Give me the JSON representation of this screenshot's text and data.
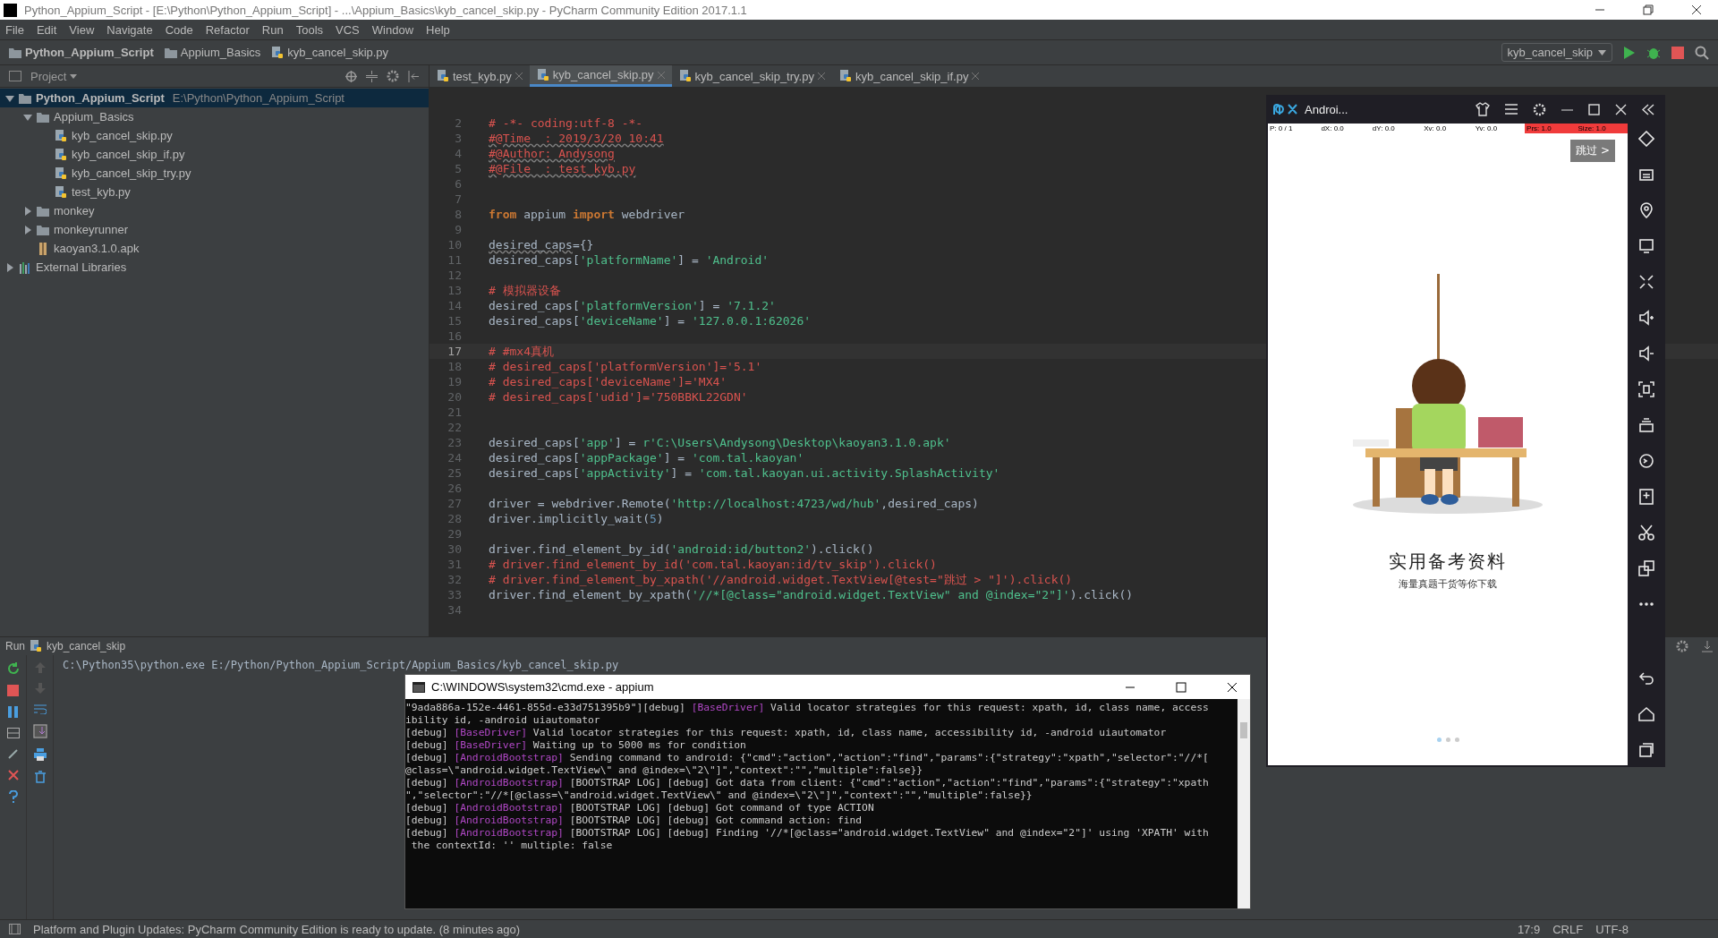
{
  "window": {
    "title": "Python_Appium_Script - [E:\\Python\\Python_Appium_Script] - ...\\Appium_Basics\\kyb_cancel_skip.py - PyCharm Community Edition 2017.1.1"
  },
  "menu": [
    "File",
    "Edit",
    "View",
    "Navigate",
    "Code",
    "Refactor",
    "Run",
    "Tools",
    "VCS",
    "Window",
    "Help"
  ],
  "breadcrumbs": [
    {
      "label": "Python_Appium_Script",
      "kind": "project"
    },
    {
      "label": "Appium_Basics",
      "kind": "folder"
    },
    {
      "label": "kyb_cancel_skip.py",
      "kind": "python"
    }
  ],
  "run_config": "kyb_cancel_skip",
  "project_panel": {
    "title": "Project"
  },
  "project_tree": [
    {
      "label": "Python_Appium_Script",
      "path": "E:\\Python\\Python_Appium_Script",
      "kind": "project",
      "expanded": true,
      "selected": true,
      "children": [
        {
          "label": "Appium_Basics",
          "kind": "folder",
          "expanded": true,
          "selected": false,
          "children": [
            {
              "label": "kyb_cancel_skip.py",
              "kind": "python",
              "selected": false
            },
            {
              "label": "kyb_cancel_skip_if.py",
              "kind": "python",
              "selected": false
            },
            {
              "label": "kyb_cancel_skip_try.py",
              "kind": "python",
              "selected": false
            },
            {
              "label": "test_kyb.py",
              "kind": "python",
              "selected": false
            }
          ]
        },
        {
          "label": "monkey",
          "kind": "folder",
          "expanded": false,
          "selected": false
        },
        {
          "label": "monkeyrunner",
          "kind": "folder",
          "expanded": false,
          "selected": false
        },
        {
          "label": "kaoyan3.1.0.apk",
          "kind": "apk",
          "selected": false
        }
      ]
    },
    {
      "label": "External Libraries",
      "kind": "library",
      "expanded": false,
      "selected": false
    }
  ],
  "tabs": [
    {
      "label": "test_kyb.py",
      "selected": false
    },
    {
      "label": "kyb_cancel_skip.py",
      "selected": true
    },
    {
      "label": "kyb_cancel_skip_try.py",
      "selected": false
    },
    {
      "label": "kyb_cancel_skip_if.py",
      "selected": false
    }
  ],
  "code": [
    {
      "number": "2",
      "current": false,
      "tokens": [
        {
          "kind": "comment",
          "text": "# -*- coding:utf-8 -*-"
        }
      ]
    },
    {
      "number": "3",
      "current": false,
      "tokens": [
        {
          "kind": "comment",
          "text": "#@Time  : 2019/3/20 10:41",
          "wavy": true
        }
      ]
    },
    {
      "number": "4",
      "current": false,
      "tokens": [
        {
          "kind": "comment",
          "text": "#@Author: Andysong",
          "wavy": true
        }
      ]
    },
    {
      "number": "5",
      "current": false,
      "tokens": [
        {
          "kind": "comment",
          "text": "#@File  : test_kyb.py",
          "wavy": true
        }
      ]
    },
    {
      "number": "6",
      "current": false
    },
    {
      "number": "7",
      "current": false
    },
    {
      "number": "8",
      "current": false,
      "tokens": [
        {
          "kind": "keyword",
          "text": "from"
        },
        {
          "kind": "plain",
          "text": " appium "
        },
        {
          "kind": "keyword",
          "text": "import"
        },
        {
          "kind": "plain",
          "text": " webdriver"
        }
      ]
    },
    {
      "number": "9",
      "current": false
    },
    {
      "number": "10",
      "current": false,
      "tokens": [
        {
          "kind": "plain",
          "text": "desired_caps",
          "wavy": true
        },
        {
          "kind": "plain",
          "text": "={}"
        }
      ]
    },
    {
      "number": "11",
      "current": false,
      "tokens": [
        {
          "kind": "plain",
          "text": "desired_caps["
        },
        {
          "kind": "string",
          "text": "'platformName'"
        },
        {
          "kind": "plain",
          "text": "] = "
        },
        {
          "kind": "string",
          "text": "'Android'"
        }
      ]
    },
    {
      "number": "12",
      "current": false
    },
    {
      "number": "13",
      "current": false,
      "tokens": [
        {
          "kind": "comment",
          "text": "# 模拟器设备"
        }
      ]
    },
    {
      "number": "14",
      "current": false,
      "tokens": [
        {
          "kind": "plain",
          "text": "desired_caps["
        },
        {
          "kind": "string",
          "text": "'platformVersion'"
        },
        {
          "kind": "plain",
          "text": "] = "
        },
        {
          "kind": "string",
          "text": "'7.1.2'"
        }
      ]
    },
    {
      "number": "15",
      "current": false,
      "tokens": [
        {
          "kind": "plain",
          "text": "desired_caps["
        },
        {
          "kind": "string",
          "text": "'deviceName'"
        },
        {
          "kind": "plain",
          "text": "] = "
        },
        {
          "kind": "string",
          "text": "'127.0.0.1:62026'"
        }
      ]
    },
    {
      "number": "16",
      "current": false
    },
    {
      "number": "17",
      "current": true,
      "tokens": [
        {
          "kind": "comment",
          "text": "# #mx4真机"
        }
      ]
    },
    {
      "number": "18",
      "current": false,
      "tokens": [
        {
          "kind": "comment",
          "text": "# desired_caps['platformVersion']='5.1'"
        }
      ]
    },
    {
      "number": "19",
      "current": false,
      "tokens": [
        {
          "kind": "comment",
          "text": "# desired_caps['deviceName']='MX4'"
        }
      ]
    },
    {
      "number": "20",
      "current": false,
      "tokens": [
        {
          "kind": "comment",
          "text": "# desired_caps['udid']='750BBKL22GDN'"
        }
      ]
    },
    {
      "number": "21",
      "current": false
    },
    {
      "number": "22",
      "current": false
    },
    {
      "number": "23",
      "current": false,
      "tokens": [
        {
          "kind": "plain",
          "text": "desired_caps["
        },
        {
          "kind": "string",
          "text": "'app'"
        },
        {
          "kind": "plain",
          "text": "] = "
        },
        {
          "kind": "string",
          "text": "r'C:\\Users\\Andysong\\Desktop\\kaoyan3.1.0.apk'"
        }
      ]
    },
    {
      "number": "24",
      "current": false,
      "tokens": [
        {
          "kind": "plain",
          "text": "desired_caps["
        },
        {
          "kind": "string",
          "text": "'appPackage'"
        },
        {
          "kind": "plain",
          "text": "] = "
        },
        {
          "kind": "string",
          "text": "'com.tal.kaoyan'"
        }
      ]
    },
    {
      "number": "25",
      "current": false,
      "tokens": [
        {
          "kind": "plain",
          "text": "desired_caps["
        },
        {
          "kind": "string",
          "text": "'appActivity'"
        },
        {
          "kind": "plain",
          "text": "] = "
        },
        {
          "kind": "string",
          "text": "'com.tal.kaoyan.ui.activity.SplashActivity'"
        }
      ]
    },
    {
      "number": "26",
      "current": false
    },
    {
      "number": "27",
      "current": false,
      "tokens": [
        {
          "kind": "plain",
          "text": "driver = webdriver.Remote("
        },
        {
          "kind": "string",
          "text": "'http://localhost:4723/wd/hub'"
        },
        {
          "kind": "plain",
          "text": ",desired_caps)"
        }
      ]
    },
    {
      "number": "28",
      "current": false,
      "tokens": [
        {
          "kind": "plain",
          "text": "driver.implicitly_wait("
        },
        {
          "kind": "number",
          "text": "5"
        },
        {
          "kind": "plain",
          "text": ")"
        }
      ]
    },
    {
      "number": "29",
      "current": false
    },
    {
      "number": "30",
      "current": false,
      "tokens": [
        {
          "kind": "plain",
          "text": "driver.find_element_by_id("
        },
        {
          "kind": "string",
          "text": "'android:id/button2'"
        },
        {
          "kind": "plain",
          "text": ").click()"
        }
      ]
    },
    {
      "number": "31",
      "current": false,
      "tokens": [
        {
          "kind": "comment",
          "text": "# driver.find_element_by_id('com.tal.kaoyan:id/tv_skip').click()"
        }
      ]
    },
    {
      "number": "32",
      "current": false,
      "tokens": [
        {
          "kind": "comment",
          "text": "# driver.find_element_by_xpath('//android.widget.TextView[@test=\"跳过 > \"]').click()"
        }
      ]
    },
    {
      "number": "33",
      "current": false,
      "tokens": [
        {
          "kind": "plain",
          "text": "driver.find_element_by_xpath("
        },
        {
          "kind": "string",
          "text": "'//*[@class=\"android.widget.TextView\" and @index=\"2\"]'"
        },
        {
          "kind": "plain",
          "text": ").click()"
        }
      ]
    },
    {
      "number": "34",
      "current": false
    }
  ],
  "run_panel": {
    "label": "Run",
    "config": "kyb_cancel_skip",
    "command": "C:\\Python35\\python.exe E:/Python/Python_Appium_Script/Appium_Basics/kyb_cancel_skip.py"
  },
  "status_bar": {
    "message": "Platform and Plugin Updates: PyCharm Community Edition is ready to update. (8 minutes ago)",
    "position": "17:9",
    "line_separator": "CRLF",
    "encoding": "UTF-8"
  },
  "emulator": {
    "title": "Androi...",
    "readouts": [
      {
        "text": "P: 0 / 1",
        "alert": false
      },
      {
        "text": "dX: 0.0",
        "alert": false
      },
      {
        "text": "dY: 0.0",
        "alert": false
      },
      {
        "text": "Xv: 0.0",
        "alert": false
      },
      {
        "text": "Yv: 0.0",
        "alert": false
      },
      {
        "text": "Prs: 1.0",
        "alert": true
      },
      {
        "text": "Size: 1.0",
        "alert": true
      }
    ],
    "skip_button": "跳过 >",
    "heading": "实用备考资料",
    "subheading": "海量真题干货等你下载",
    "page_dots": [
      {
        "selected": true
      },
      {
        "selected": false
      },
      {
        "selected": false
      }
    ]
  },
  "console_window": {
    "title": "C:\\WINDOWS\\system32\\cmd.exe - appium",
    "lines": [
      [
        {
          "kind": "plain",
          "text": "\"9ada886a-152e-4461-855d-e33d751395b9\"][debug] "
        },
        {
          "kind": "tag",
          "text": "[BaseDriver]"
        },
        {
          "kind": "plain",
          "text": " Valid locator strategies for this request: xpath, id, class name, access"
        }
      ],
      [
        {
          "kind": "plain",
          "text": "ibility id, -android uiautomator"
        }
      ],
      [
        {
          "kind": "plain",
          "text": "[debug] "
        },
        {
          "kind": "tag",
          "text": "[BaseDriver]"
        },
        {
          "kind": "plain",
          "text": " Valid locator strategies for this request: xpath, id, class name, accessibility id, -android uiautomator"
        }
      ],
      [
        {
          "kind": "plain",
          "text": "[debug] "
        },
        {
          "kind": "tag",
          "text": "[BaseDriver]"
        },
        {
          "kind": "plain",
          "text": " Waiting up to 5000 ms for condition"
        }
      ],
      [
        {
          "kind": "plain",
          "text": "[debug] "
        },
        {
          "kind": "tag",
          "text": "[AndroidBootstrap]"
        },
        {
          "kind": "plain",
          "text": " Sending command to android: {\"cmd\":\"action\",\"action\":\"find\",\"params\":{\"strategy\":\"xpath\",\"selector\":\"//*["
        }
      ],
      [
        {
          "kind": "plain",
          "text": "@class=\\\"android.widget.TextView\\\" and @index=\\\"2\\\"]\",\"context\":\"\",\"multiple\":false}}"
        }
      ],
      [
        {
          "kind": "plain",
          "text": "[debug] "
        },
        {
          "kind": "tag",
          "text": "[AndroidBootstrap]"
        },
        {
          "kind": "plain",
          "text": " [BOOTSTRAP LOG] [debug] Got data from client: {\"cmd\":\"action\",\"action\":\"find\",\"params\":{\"strategy\":\"xpath"
        }
      ],
      [
        {
          "kind": "plain",
          "text": "\",\"selector\":\"//*[@class=\\\"android.widget.TextView\\\" and @index=\\\"2\\\"]\",\"context\":\"\",\"multiple\":false}}"
        }
      ],
      [
        {
          "kind": "plain",
          "text": "[debug] "
        },
        {
          "kind": "tag",
          "text": "[AndroidBootstrap]"
        },
        {
          "kind": "plain",
          "text": " [BOOTSTRAP LOG] [debug] Got command of type ACTION"
        }
      ],
      [
        {
          "kind": "plain",
          "text": "[debug] "
        },
        {
          "kind": "tag",
          "text": "[AndroidBootstrap]"
        },
        {
          "kind": "plain",
          "text": " [BOOTSTRAP LOG] [debug] Got command action: find"
        }
      ],
      [
        {
          "kind": "plain",
          "text": "[debug] "
        },
        {
          "kind": "tag",
          "text": "[AndroidBootstrap]"
        },
        {
          "kind": "plain",
          "text": " [BOOTSTRAP LOG] [debug] Finding '//*[@class=\"android.widget.TextView\" and @index=\"2\"]' using 'XPATH' with"
        }
      ],
      [
        {
          "kind": "plain",
          "text": " the contextId: '' multiple: false"
        }
      ]
    ]
  }
}
